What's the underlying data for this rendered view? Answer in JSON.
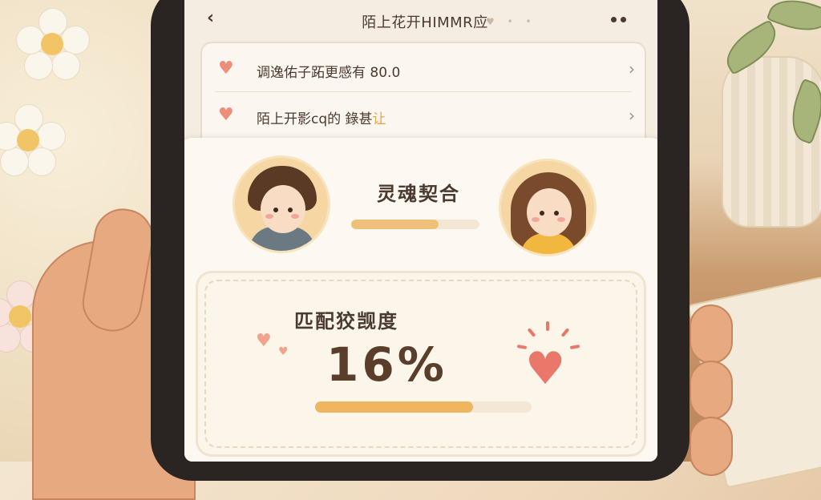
{
  "header": {
    "title": "陌上花开HIMMR应",
    "title_deco": "♥ • •",
    "back_icon": "chevron-left-icon",
    "more_icon": "more-dots-icon"
  },
  "list": {
    "items": [
      {
        "icon": "heart-icon",
        "label": "调逸佑子跖更感有 80.0",
        "accent": ""
      },
      {
        "icon": "heart-icon",
        "label": "陌上开影cq的 錄甚",
        "accent": "让"
      }
    ]
  },
  "soul": {
    "label": "灵魂契合",
    "progress": 0.68
  },
  "match": {
    "label": "匹配狡觊度",
    "percent_text": "16%",
    "progress": 0.73
  },
  "colors": {
    "accent": "#e9776a",
    "progress": "#efb55f",
    "background": "#fdf9f2"
  }
}
